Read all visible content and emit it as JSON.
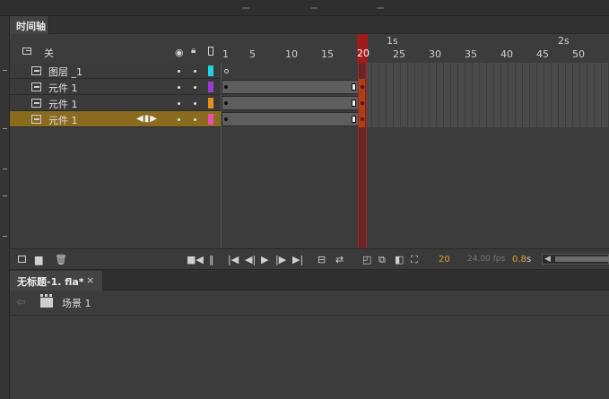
{
  "panel": {
    "tab_label": "时间轴"
  },
  "layer_header": {
    "label": "关",
    "icons": [
      "layer-icon",
      "eye-icon",
      "lock-icon",
      "outline-icon"
    ]
  },
  "ruler": {
    "seconds": [
      "1s",
      "2s"
    ],
    "frames": [
      "1",
      "5",
      "10",
      "15",
      "20",
      "25",
      "30",
      "35",
      "40",
      "45",
      "50"
    ],
    "current_frame": "20"
  },
  "layers": [
    {
      "name": "图层 _1",
      "color": "#1fd3e6",
      "selected": false
    },
    {
      "name": "元件 1",
      "color": "#9a3ad6",
      "selected": false
    },
    {
      "name": "元件 1",
      "color": "#e8901a",
      "selected": false
    },
    {
      "name": "元件 1",
      "color": "#e84fb0",
      "selected": true
    }
  ],
  "toolbar": {
    "current_frame": "20",
    "fps": "24.00 fps",
    "time": "0.8",
    "time_unit": "s",
    "icons": [
      "new-layer-icon",
      "new-folder-icon",
      "delete-icon",
      "camera-icon",
      "first-frame-icon",
      "prev-frame-icon",
      "play-icon",
      "next-frame-icon",
      "last-frame-icon",
      "loop-icon",
      "center-frame-icon",
      "onion-skin-icon",
      "onion-outline-icon",
      "edit-multiple-icon",
      "onion-markers-icon"
    ]
  },
  "document": {
    "tab_label": "无标题-1. fla*",
    "close_glyph": "×"
  },
  "scene": {
    "label": "场景 1"
  }
}
